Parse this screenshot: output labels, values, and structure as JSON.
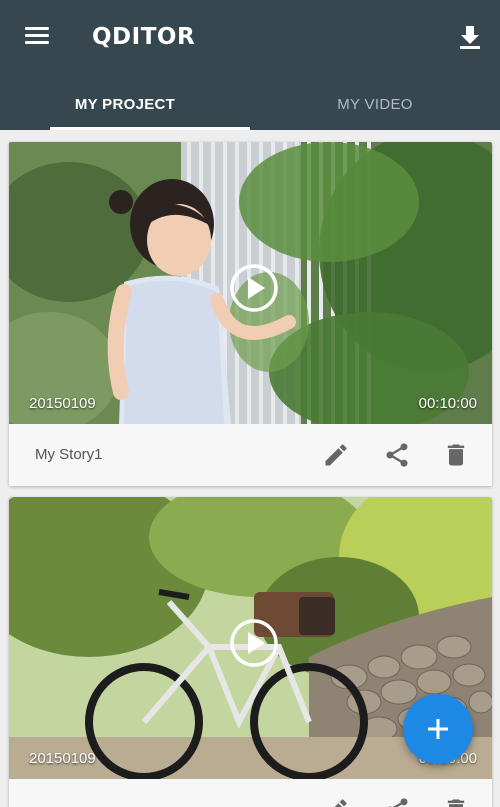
{
  "app": {
    "logo_text": "QDITOR",
    "menu_icon": "hamburger-menu-icon",
    "download_icon": "download-icon",
    "colors": {
      "appbar": "#37474f",
      "fab": "#1e88e5",
      "tab_inactive": "#b0bcc2"
    }
  },
  "tabs": [
    {
      "label": "MY PROJECT",
      "active": true
    },
    {
      "label": "MY VIDEO",
      "active": false
    }
  ],
  "projects": [
    {
      "date": "20150109",
      "duration": "00:10:00",
      "title": "My Story1"
    },
    {
      "date": "20150109",
      "duration": "00:10:00",
      "title": ""
    }
  ],
  "actions": [
    "edit-icon",
    "share-icon",
    "delete-icon"
  ],
  "fab": {
    "icon": "plus-icon"
  }
}
